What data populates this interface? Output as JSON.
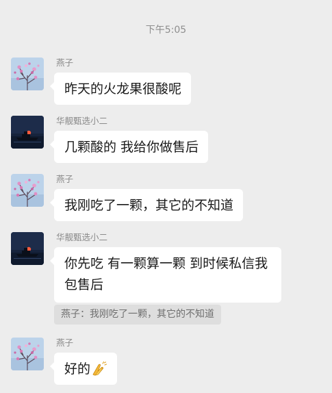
{
  "chat": {
    "timestamp": "下午5:05",
    "messages": [
      {
        "sender": "燕子",
        "text": "昨天的火龙果很酸呢",
        "avatar": "blossom-avatar"
      },
      {
        "sender": "华靓甄选小二",
        "text": "几颗酸的 我给你做售后",
        "avatar": "ship-sunset-avatar"
      },
      {
        "sender": "燕子",
        "text": "我刚吃了一颗，其它的不知道",
        "avatar": "blossom-avatar"
      },
      {
        "sender": "华靓甄选小二",
        "text": "你先吃 有一颗算一颗 到时候私信我 包售后",
        "avatar": "ship-sunset-avatar"
      },
      {
        "sender": "燕子",
        "text": "好的",
        "emoji": "folded-hands-emoji",
        "avatar": "blossom-avatar"
      }
    ],
    "quote": {
      "text": "燕子：我刚吃了一颗，其它的不知道"
    }
  }
}
